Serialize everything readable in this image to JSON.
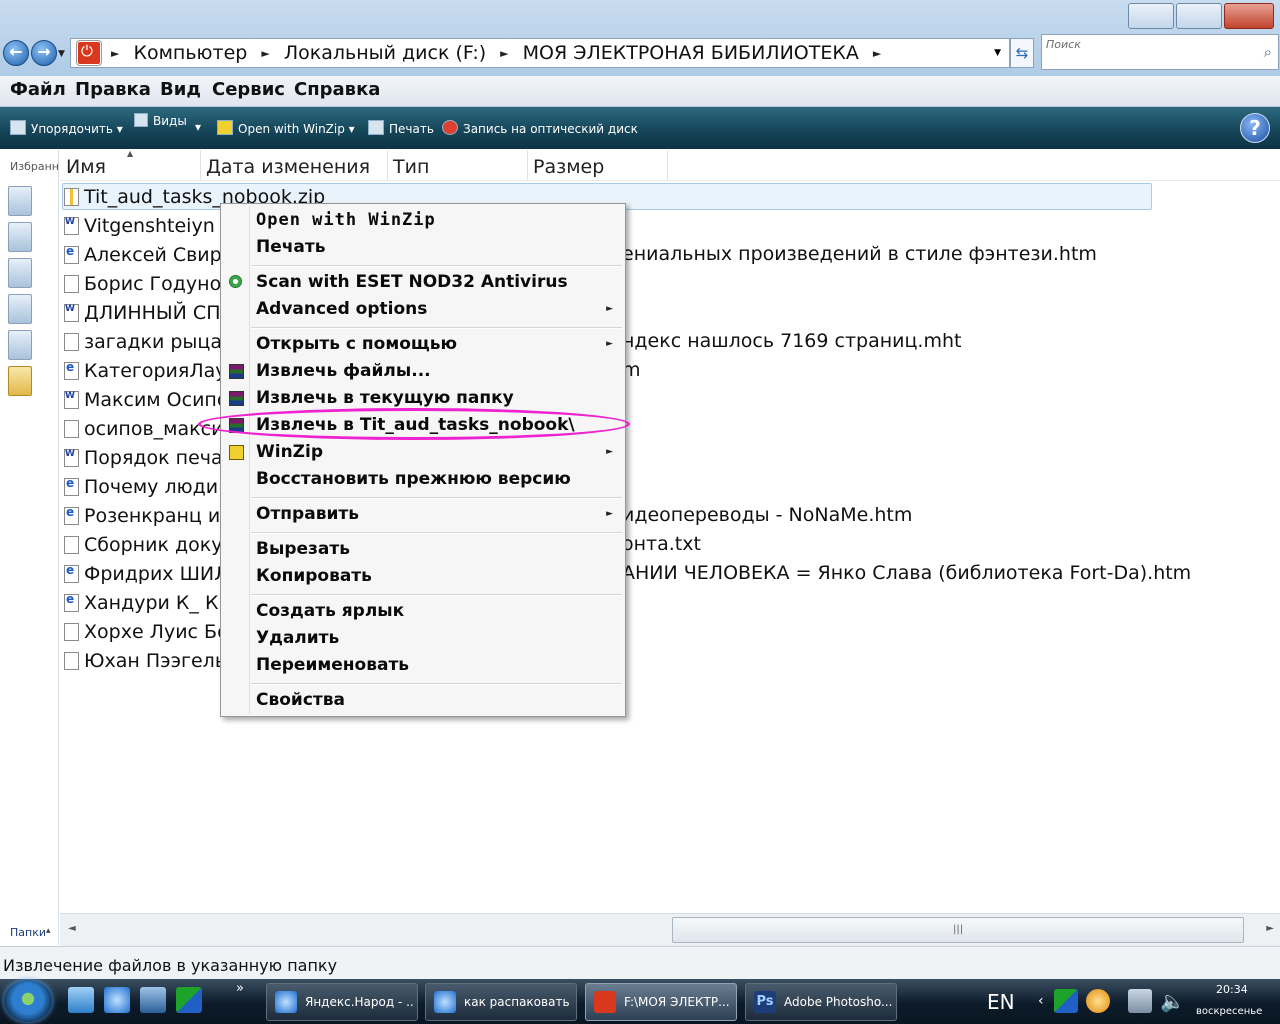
{
  "address": {
    "crumbs": [
      "Компьютер",
      "Локальный диск (F:)",
      "МОЯ ЭЛЕКТРОНАЯ БИБИЛИОТЕКА"
    ],
    "search_placeholder": "Поиск"
  },
  "menubar": [
    "Файл",
    "Правка",
    "Вид",
    "Сервис",
    "Справка"
  ],
  "toolbar": {
    "organize": "Упорядочить",
    "views": "Виды",
    "open_winzip": "Open with WinZip",
    "print": "Печать",
    "burn": "Запись на оптический диск"
  },
  "navpane": {
    "favorites_label": "Избранн",
    "folders_label": "Папки"
  },
  "columns": [
    "Имя",
    "Дата изменения",
    "Тип",
    "Размер"
  ],
  "files": [
    {
      "name": "Tit_aud_tasks_nobook.zip",
      "tail": "",
      "icon": "zip"
    },
    {
      "name": "Vitgenshteiyn L.",
      "tail": "",
      "icon": "doc"
    },
    {
      "name": "Алексей Свири",
      "tail": "ениальных произведений в стиле фэнтези.htm",
      "icon": "ie"
    },
    {
      "name": "Борис Годунов",
      "tail": "",
      "icon": "txt"
    },
    {
      "name": "ДЛИННЫЙ СПИ",
      "tail": "",
      "icon": "doc"
    },
    {
      "name": "загадки рыцаро",
      "tail": "ндекс нашлось 7169 страниц.mht",
      "icon": "mht"
    },
    {
      "name": "КатегорияЛаур",
      "tail": "m",
      "icon": "ie"
    },
    {
      "name": "Максим Осипо",
      "tail": "",
      "icon": "doc"
    },
    {
      "name": "осипов_макси",
      "tail": "",
      "icon": "txt"
    },
    {
      "name": "Порядок печат",
      "tail": "",
      "icon": "doc"
    },
    {
      "name": "Почему люди ч",
      "tail": "",
      "icon": "ie"
    },
    {
      "name": "Розенкранц и Г",
      "tail": "идеопереводы - NoNaMe.htm",
      "icon": "ie"
    },
    {
      "name": "Сборник докум",
      "tail": "онта.txt",
      "icon": "txt"
    },
    {
      "name": "Фридрих ШИЛЛ",
      "tail": "АНИИ ЧЕЛОВЕКА = Янко Слава (библиотека Fort-Da).htm",
      "icon": "ie"
    },
    {
      "name": "Хандури К_ Кру",
      "tail": "",
      "icon": "ie"
    },
    {
      "name": "Хорхе Луис Бор",
      "tail": "",
      "icon": "txt"
    },
    {
      "name": "Юхан Пээгель_",
      "tail": "",
      "icon": "txt"
    }
  ],
  "context_menu": {
    "open_winzip": "Open with WinZip",
    "print": "Печать",
    "scan_eset": "Scan with ESET NOD32 Antivirus",
    "advanced": "Advanced options",
    "open_with": "Открыть с помощью",
    "extract_files": "Извлечь файлы...",
    "extract_here": "Извлечь в текущую папку",
    "extract_to": "Извлечь в Tit_aud_tasks_nobook\\",
    "winzip": "WinZip",
    "restore": "Восстановить прежнюю версию",
    "send_to": "Отправить",
    "cut": "Вырезать",
    "copy": "Копировать",
    "shortcut": "Создать ярлык",
    "delete": "Удалить",
    "rename": "Переименовать",
    "properties": "Свойства"
  },
  "status": "Извлечение файлов в указанную папку",
  "taskbar": {
    "tasks": [
      "Яндекс.Народ - ...",
      "как распаковать ...",
      "F:\\МОЯ ЭЛЕКТР...",
      "Adobe Photosho..."
    ],
    "lang": "EN",
    "time": "20:34",
    "day": "воскресенье"
  },
  "colors": {
    "highlight_ellipse": "#ee22d0",
    "selection": "#e9f3fc"
  }
}
